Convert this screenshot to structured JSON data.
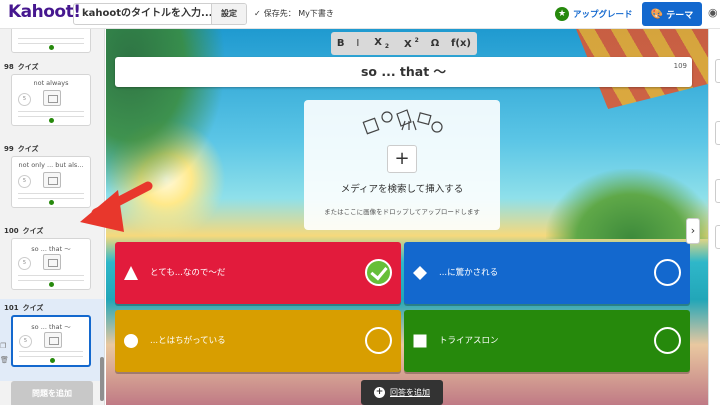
{
  "topbar": {
    "logo": "Kahoot!",
    "kahoot_title": "kahootのタイトルを入力...",
    "settings_label": "設定",
    "saved_check": "✓",
    "saved_label": "保存先： My下書き",
    "upgrade_label": "アップグレード",
    "theme_label": "テーマ"
  },
  "sidebar": {
    "slides": [
      {
        "number": "",
        "type": "",
        "title": ""
      },
      {
        "number": "98",
        "type": "クイズ",
        "title": "not always",
        "count": "5"
      },
      {
        "number": "99",
        "type": "クイズ",
        "title": "not only ... but als...",
        "count": "5"
      },
      {
        "number": "100",
        "type": "クイズ",
        "title": "so ... that 〜",
        "count": "5"
      },
      {
        "number": "101",
        "type": "クイズ",
        "title": "so ... that 〜",
        "count": "5"
      }
    ],
    "add_question_label": "問題を追加"
  },
  "format_bar": {
    "bold": "B",
    "italic": "I",
    "subscript_base": "X",
    "subscript": "2",
    "superscript_base": "X",
    "superscript": "2",
    "omega": "Ω",
    "fx": "f(x)"
  },
  "question": {
    "text": "so ... that 〜",
    "char_count": "109"
  },
  "media": {
    "plus": "+",
    "label": "メディアを検索して挿入する",
    "sublabel": "またはここに画像をドロップしてアップロードします"
  },
  "answers": [
    {
      "text": "とても...なので〜だ",
      "shape": "triangle",
      "color": "#e21b3c",
      "correct": true
    },
    {
      "text": "...に驚かされる",
      "shape": "diamond",
      "color": "#1368ce",
      "correct": false
    },
    {
      "text": "...とはちがっている",
      "shape": "circle",
      "color": "#d89e00",
      "correct": false
    },
    {
      "text": "トライアスロン",
      "shape": "square",
      "color": "#26890c",
      "correct": false
    }
  ],
  "add_answer_label": "回答を追加",
  "colors": {
    "brand": "#46178f",
    "primary": "#1368ce",
    "red": "#e21b3c",
    "blue": "#1368ce",
    "yellow": "#d89e00",
    "green": "#26890c",
    "arrow": "#e8372c"
  }
}
